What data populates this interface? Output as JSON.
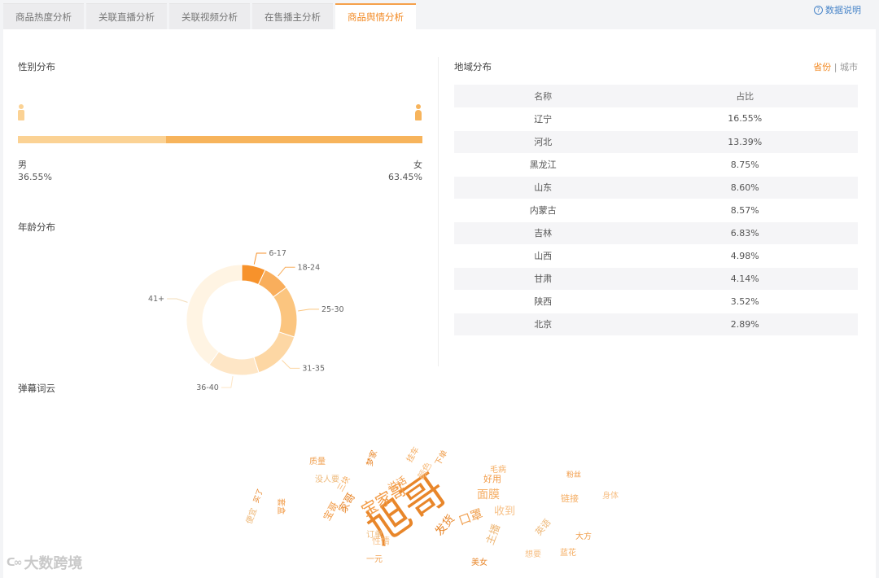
{
  "tabs": [
    {
      "label": "商品热度分析",
      "active": false
    },
    {
      "label": "关联直播分析",
      "active": false
    },
    {
      "label": "关联视频分析",
      "active": false
    },
    {
      "label": "在售播主分析",
      "active": false
    },
    {
      "label": "商品舆情分析",
      "active": true
    }
  ],
  "help_label": "数据说明",
  "gender": {
    "title": "性别分布",
    "male_label": "男",
    "male_pct": "36.55%",
    "female_label": "女",
    "female_pct": "63.45%",
    "male_fraction": 0.3655,
    "colors": {
      "male": "#fbd294",
      "female": "#f7b45c"
    }
  },
  "age": {
    "title": "年龄分布",
    "segments": [
      {
        "label": "6-17",
        "value": 7,
        "color": "#f7922b"
      },
      {
        "label": "18-24",
        "value": 8,
        "color": "#f9ae5c"
      },
      {
        "label": "25-30",
        "value": 15,
        "color": "#fbc57f"
      },
      {
        "label": "31-35",
        "value": 15,
        "color": "#fdd7a4"
      },
      {
        "label": "36-40",
        "value": 15,
        "color": "#fee6c6"
      },
      {
        "label": "41+",
        "value": 40,
        "color": "#fff4e3"
      }
    ]
  },
  "region": {
    "title": "地域分布",
    "toggle_province": "省份",
    "toggle_sep": "|",
    "toggle_city": "城市",
    "columns": [
      "名称",
      "占比"
    ],
    "rows": [
      [
        "辽宁",
        "16.55%"
      ],
      [
        "河北",
        "13.39%"
      ],
      [
        "黑龙江",
        "8.75%"
      ],
      [
        "山东",
        "8.60%"
      ],
      [
        "内蒙古",
        "8.57%"
      ],
      [
        "吉林",
        "6.83%"
      ],
      [
        "山西",
        "4.98%"
      ],
      [
        "甘肃",
        "4.14%"
      ],
      [
        "陕西",
        "3.52%"
      ],
      [
        "北京",
        "2.89%"
      ]
    ]
  },
  "cloud": {
    "title": "弹幕词云",
    "words": [
      "旭哥",
      "宝家哥",
      "面膜",
      "收到",
      "口罩",
      "主播",
      "发货",
      "好用",
      "毛病",
      "性情",
      "一元",
      "英语",
      "家哥",
      "宝哥",
      "链接",
      "身体",
      "质量",
      "没人要",
      "梦家",
      "粉丝",
      "蓝花",
      "想要",
      "大方",
      "订单",
      "美女",
      "套盒",
      "挂车",
      "颜色",
      "下单",
      "便宜",
      "买了",
      "说话",
      "三块"
    ]
  },
  "watermark": "大数跨境"
}
